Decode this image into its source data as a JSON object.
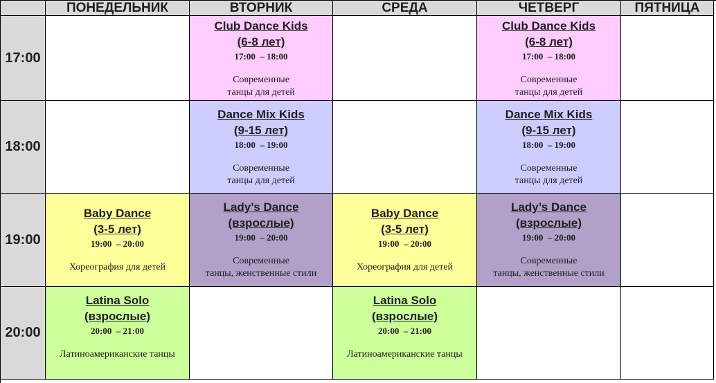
{
  "days": [
    "ПОНЕДЕЛЬНИК",
    "ВТОРНИК",
    "СРЕДА",
    "ЧЕТВЕРГ",
    "ПЯТНИЦА"
  ],
  "times": [
    "17:00",
    "18:00",
    "19:00",
    "20:00"
  ],
  "classes": {
    "club_dance_kids": {
      "name": "Club Dance Kids",
      "age": "(6-8 лет)",
      "time": "17:00  – 18:00",
      "desc_line1": "Современные",
      "desc_line2": "танцы для детей"
    },
    "dance_mix_kids": {
      "name": "Dance Mix Kids",
      "age": "(9-15 лет)",
      "time": "18:00  – 19:00",
      "desc_line1": "Современные",
      "desc_line2": "танцы для детей"
    },
    "baby_dance": {
      "name": "Baby Dance",
      "age": "(3-5 лет)",
      "time": "19:00  – 20:00",
      "desc_line1": "Хореография для детей"
    },
    "ladys_dance": {
      "name": "Lady’s Dance",
      "age": "(взрослые)",
      "time": "19:00  – 20:00",
      "desc_line1": "Современные",
      "desc_line2": "танцы, женственные стили"
    },
    "latina_solo": {
      "name": "Latina Solo",
      "age": "(взрослые)",
      "time": "20:00  – 21:00",
      "desc_line1": "Латиноамериканские танцы"
    }
  },
  "colors": {
    "header_bg": "#d9d9d9",
    "children_modern": "#ffccff",
    "children_mix": "#ccccff",
    "baby": "#ffff99",
    "lady": "#b1a0c7",
    "latina": "#ccff99"
  }
}
